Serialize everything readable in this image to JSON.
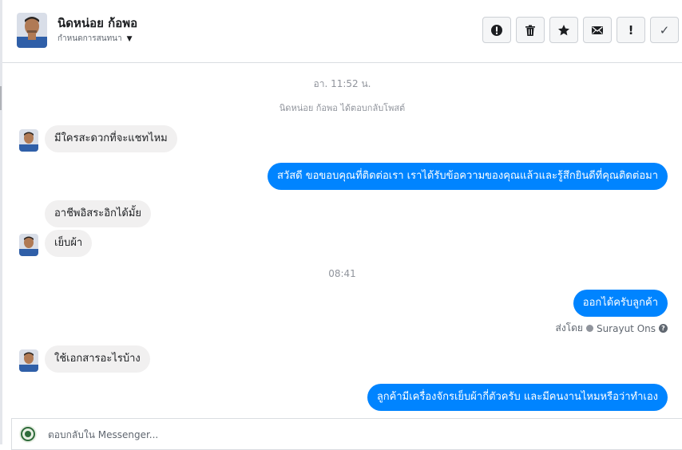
{
  "contact": {
    "name": "นิดหน่อย ก้อพอ",
    "status_label": "กำหนดการสนทนา"
  },
  "toolbar": {
    "spam_icon": "alert-circle-icon",
    "delete_icon": "trash-icon",
    "star_icon": "star-icon",
    "unread_icon": "envelope-icon",
    "important_glyph": "!",
    "done_glyph": "✓"
  },
  "conversation": {
    "time_1": "อา. 11:52 น.",
    "system_note": "นิดหน่อย ก้อพอ ได้ตอบกลับโพสต์",
    "msg_in_1": "มีใครสะดวกที่จะแชทไหม",
    "msg_out_1": "สวัสดี ขอขอบคุณที่ติดต่อเรา เราได้รับข้อความของคุณแล้วและรู้สึกยินดีที่คุณติดต่อมา",
    "msg_in_2": "อาชีพอิสระอิกได้มั้ย",
    "msg_in_3": "เย็บผ้า",
    "time_2": "08:41",
    "msg_out_2": "ออกได้ครับลูกค้า",
    "sent_by_prefix": "ส่งโดย",
    "sent_by_name": "Surayut Ons",
    "help_glyph": "?",
    "msg_in_4": "ใช้เอกสารอะไรบ้าง",
    "msg_out_3": "ลูกค้ามีเครื่องจักรเย็บผ้ากี่ตัวครับ และมีคนงานไหมหรือว่าทำเอง"
  },
  "composer": {
    "placeholder": "ตอบกลับใน Messenger..."
  },
  "colors": {
    "outgoing_bubble": "#0084ff",
    "incoming_bubble": "#f1f0f0",
    "system_text": "#90949c"
  }
}
